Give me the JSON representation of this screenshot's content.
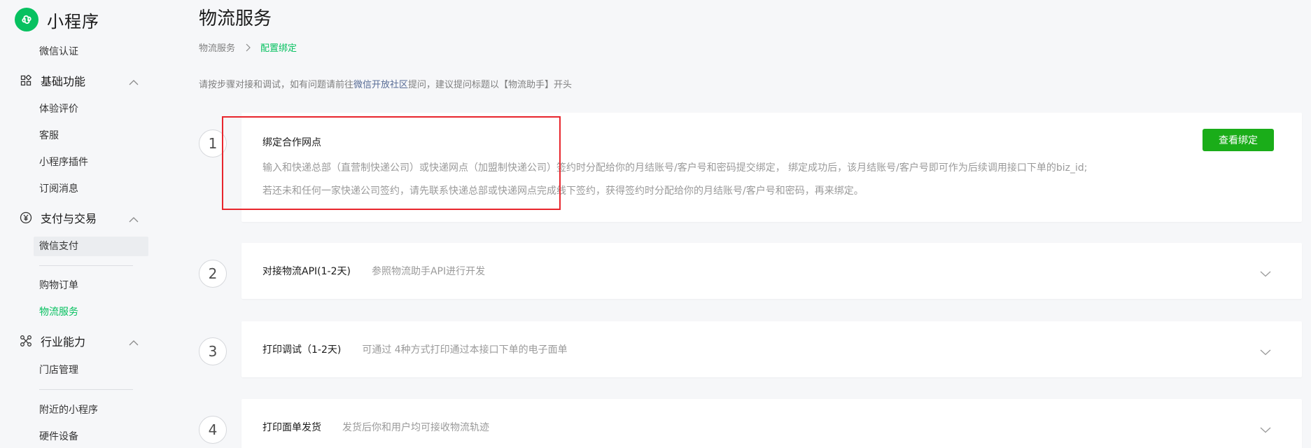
{
  "app": {
    "name": "小程序"
  },
  "sidebar": {
    "items": {
      "wechat_verify": "微信认证",
      "group_basic": "基础功能",
      "experience": "体验评价",
      "customer_service": "客服",
      "plugins": "小程序插件",
      "subscription": "订阅消息",
      "group_payment": "支付与交易",
      "wechat_pay": "微信支付",
      "shopping_orders": "购物订单",
      "logistics": "物流服务",
      "group_industry": "行业能力",
      "store_mgmt": "门店管理",
      "nearby": "附近的小程序",
      "hardware": "硬件设备"
    }
  },
  "page": {
    "title": "物流服务",
    "breadcrumb": {
      "root": "物流服务",
      "current": "配置绑定"
    },
    "intro": {
      "before": "请按步骤对接和调试，如有问题请前往",
      "link": "微信开放社区",
      "after": "提问，建议提问标题以【物流助手】开头"
    }
  },
  "steps": [
    {
      "num": "1",
      "title": "绑定合作网点",
      "p1": "输入和快递总部（直营制快递公司）或快递网点（加盟制快递公司）签约时分配给你的月结账号/客户号和密码提交绑定， 绑定成功后，该月结账号/客户号即可作为后续调用接口下单的biz_id;",
      "p2": "若还未和任何一家快递公司签约，请先联系快递总部或快递网点完成线下签约，获得签约时分配给你的月结账号/客户号和密码，再来绑定。",
      "button": "查看绑定"
    },
    {
      "num": "2",
      "title": "对接物流API(1-2天)",
      "desc": "参照物流助手API进行开发"
    },
    {
      "num": "3",
      "title": "打印调试（1-2天)",
      "desc": "可通过 4种方式打印通过本接口下单的电子面单"
    },
    {
      "num": "4",
      "title": "打印面单发货",
      "desc": "发货后你和用户均可接收物流轨迹"
    }
  ],
  "colors": {
    "accent": "#07c160",
    "button": "#1aad19",
    "annotation": "#e8262d",
    "link": "#576b95"
  }
}
